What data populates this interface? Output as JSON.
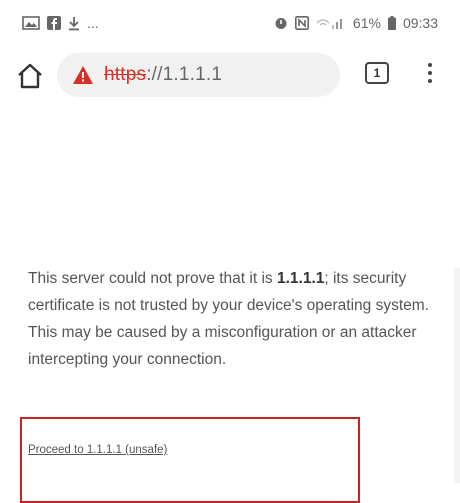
{
  "status_bar": {
    "left_icons": [
      "gallery-icon",
      "facebook-icon",
      "download-icon"
    ],
    "more_dots": "...",
    "right_icons": [
      "alarm-icon",
      "nfc-icon",
      "signal-icon"
    ],
    "battery_percent": "61%",
    "time": "09:33"
  },
  "toolbar": {
    "home_icon": "home-icon",
    "warning_icon": "warning-triangle-icon",
    "url_scheme": "https",
    "url_rest": "://1.1.1.1",
    "tab_count": "1",
    "menu_icon": "three-dot-menu-icon"
  },
  "interstitial": {
    "text_before": "This server could not prove that it is ",
    "host": "1.1.1.1",
    "text_after": "; its security certificate is not trusted by your device's operating system. This may be caused by a misconfiguration or an attacker intercepting your connection.",
    "proceed_link": "Proceed to 1.1.1.1 (unsafe)"
  },
  "colors": {
    "warning": "#d93025",
    "highlight_box": "#cc2222",
    "omnibox_bg": "#f1f1f1"
  }
}
